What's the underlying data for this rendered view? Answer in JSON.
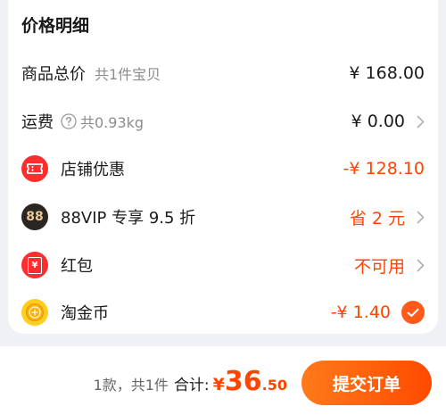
{
  "price_detail": {
    "title": "价格明细",
    "subtotal": {
      "label": "商品总价",
      "sub": "共1件宝贝",
      "amount": "¥ 168.00"
    },
    "shipping": {
      "label": "运费",
      "sub": "共0.93kg",
      "amount": "¥ 0.00"
    },
    "store_discount": {
      "label": "店铺优惠",
      "amount": "-¥ 128.10"
    },
    "vip": {
      "label": "88VIP 专享 9.5 折",
      "icon_text": "88",
      "amount": "省 2 元"
    },
    "red_packet": {
      "label": "红包",
      "icon_text": "¥",
      "amount": "不可用"
    },
    "gold_coin": {
      "label": "淘金币",
      "amount": "-¥ 1.40",
      "checked": true
    }
  },
  "footer": {
    "count": "1款，共1件",
    "total_label": "合计:",
    "currency": "¥",
    "total_int": "36",
    "total_dec": ".50",
    "submit_label": "提交订单"
  },
  "colors": {
    "accent": "#ff4400",
    "button_start": "#ff7a1a",
    "button_end": "#ff4a00",
    "background": "#f0f1f4"
  },
  "icons": [
    "help-circle-icon",
    "chevron-right-icon",
    "ticket-icon",
    "vip-88-icon",
    "red-packet-icon",
    "gold-coin-icon",
    "check-icon"
  ]
}
